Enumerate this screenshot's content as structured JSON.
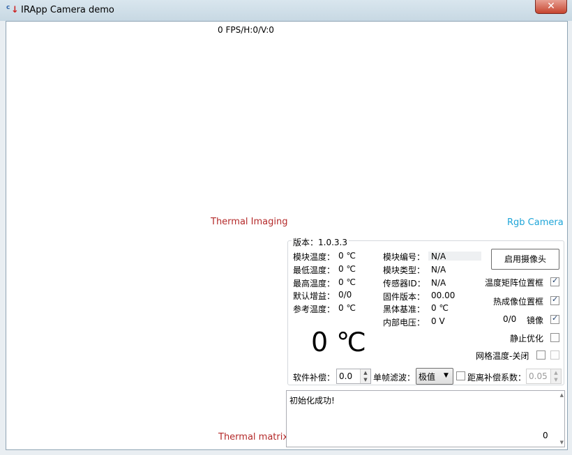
{
  "window": {
    "title": "IRApp Camera demo",
    "close_label": "✕"
  },
  "video": {
    "fps_status": "0 FPS/H:0/V:0",
    "thermal_imaging_label": "Thermal Imaging",
    "rgb_camera_label": "Rgb Camera",
    "thermal_matrix_label": "Thermal matrix"
  },
  "info": {
    "version_legend": "版本：1.0.3.3",
    "left_rows": [
      {
        "label": "模块温度：",
        "value": "0 ℃"
      },
      {
        "label": "最低温度：",
        "value": "0 ℃"
      },
      {
        "label": "最高温度：",
        "value": "0 ℃"
      },
      {
        "label": "默认增益：",
        "value": "0/0"
      },
      {
        "label": "参考温度：",
        "value": "0 ℃"
      }
    ],
    "right_rows": [
      {
        "label": "模块编号：",
        "value": "N/A"
      },
      {
        "label": "模块类型：",
        "value": "N/A"
      },
      {
        "label": "传感器ID：",
        "value": "N/A"
      },
      {
        "label": "固件版本：",
        "value": "00.00"
      },
      {
        "label": "黑体基准：",
        "value": "0 ℃"
      },
      {
        "label": "内部电压：",
        "value": "0 V"
      }
    ],
    "big_temperature": "0 ℃"
  },
  "controls": {
    "start_camera_button": "启用摄像头",
    "checkboxes": [
      {
        "label": "温度矩阵位置框",
        "checked": true
      },
      {
        "label": "热成像位置框",
        "checked": true
      },
      {
        "label": "镜像",
        "checked": true
      },
      {
        "label": "静止优化",
        "checked": false
      },
      {
        "label": "网格温度-关闭",
        "checked": false
      }
    ],
    "mirror_counter": "0/0",
    "software_comp_label": "软件补偿：",
    "software_comp_value": "0.0",
    "frame_filter_label": "单帧滤波：",
    "frame_filter_value": "极值",
    "distance_comp_label": "距离补偿系数：",
    "distance_comp_value": "0.05"
  },
  "log": {
    "message": "初始化成功!",
    "counter": "0"
  }
}
